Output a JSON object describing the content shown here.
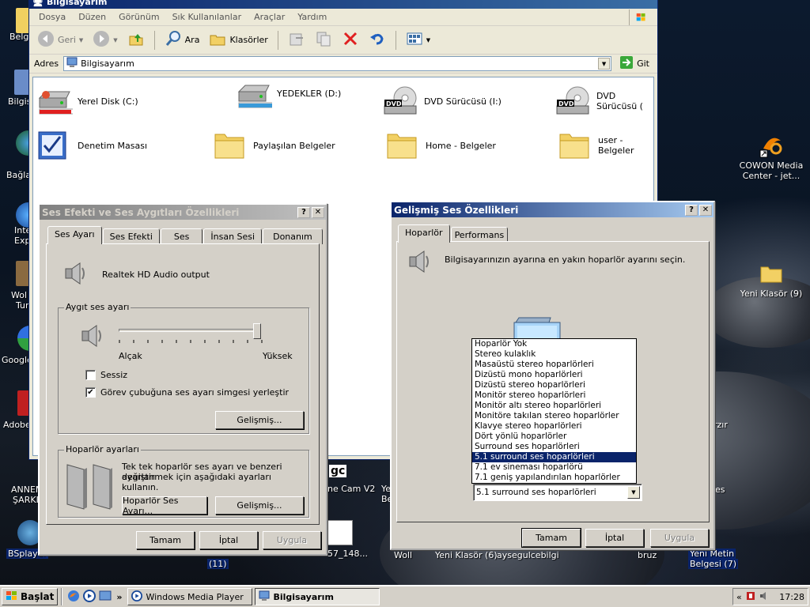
{
  "desktop": {
    "icons": [
      {
        "label": "COWON Media Center - jet...",
        "icon": "cowon-icon"
      },
      {
        "label": "Yeni Klasör (9)",
        "icon": "folder-icon"
      }
    ],
    "fragments": [
      {
        "text": "Belg",
        "name": "desktop-icon-belgelerim"
      },
      {
        "text": "Bilgis",
        "name": "desktop-icon-bilgisayarim"
      },
      {
        "text": "Bağla",
        "name": "desktop-icon-baglantilar"
      },
      {
        "text": "Inte",
        "name": "desktop-icon-internet-1"
      },
      {
        "text": "Exp",
        "name": "desktop-icon-internet-2"
      },
      {
        "text": "Wol",
        "name": "desktop-icon-wol-1"
      },
      {
        "text": "Tur",
        "name": "desktop-icon-wol-2"
      },
      {
        "text": "Google",
        "name": "desktop-icon-google"
      },
      {
        "text": "Adobe",
        "name": "desktop-icon-adobe"
      },
      {
        "text": "ANNEM",
        "name": "desktop-icon-annem-1"
      },
      {
        "text": "ŞARKI",
        "name": "desktop-icon-annem-2"
      },
      {
        "text": "BSplayer",
        "name": "desktop-icon-bsplayer"
      },
      {
        "text": "(11)",
        "name": "desktop-icon-fragment-11"
      },
      {
        "text": "57_148...",
        "name": "desktop-icon-fragment-57"
      },
      {
        "text": "ne Cam V2",
        "name": "desktop-icon-fragment-cam"
      },
      {
        "text": "gc",
        "name": "desktop-icon-fragment-gc"
      },
      {
        "text": "Ye",
        "name": "desktop-icon-fragment-ye"
      },
      {
        "text": "Be",
        "name": "desktop-icon-fragment-be"
      },
      {
        "text": "rzır",
        "name": "desktop-icon-fragment-rzir"
      },
      {
        "text": "es",
        "name": "desktop-icon-fragment-es"
      },
      {
        "text": "Yeni Metin",
        "name": "desktop-icon-yeni-metin-1"
      },
      {
        "text": "Belgesi (7)",
        "name": "desktop-icon-yeni-metin-2"
      },
      {
        "text": "Woll",
        "name": "desktop-icon-fragment-woll"
      },
      {
        "text": "Yeni Klasör (6)",
        "name": "desktop-icon-fragment-klasor6"
      },
      {
        "text": "aysegulcebilgi",
        "name": "desktop-icon-fragment-aysegul"
      },
      {
        "text": "bruz",
        "name": "desktop-icon-fragment-bruz"
      }
    ]
  },
  "explorer": {
    "title": "Bilgisayarım",
    "menu": [
      "Dosya",
      "Düzen",
      "Görünüm",
      "Sık Kullanılanlar",
      "Araçlar",
      "Yardım"
    ],
    "toolbar": {
      "back": "Geri",
      "search": "Ara",
      "folders": "Klasörler"
    },
    "address_label": "Adres",
    "address_value": "Bilgisayarım",
    "go_label": "Git",
    "items": [
      {
        "label": "Yerel Disk (C:)",
        "type": "hdd",
        "usage": 0.9
      },
      {
        "label": "YEDEKLER (D:)",
        "type": "hdd",
        "usage": 0.95
      },
      {
        "label": "DVD Sürücüsü (I:)",
        "type": "dvd"
      },
      {
        "label": "DVD Sürücüsü (",
        "type": "dvd"
      },
      {
        "label": "Denetim Masası",
        "type": "control"
      },
      {
        "label": "Paylaşılan Belgeler",
        "type": "folder"
      },
      {
        "label": "Home - Belgeler",
        "type": "folder"
      },
      {
        "label": "user - Belgeler",
        "type": "folder"
      }
    ]
  },
  "sound_dialog": {
    "title": "Ses Efekti ve Ses Aygıtları Özellikleri",
    "tabs": [
      "Ses Ayarı",
      "Ses Efekti",
      "Ses",
      "İnsan Sesi",
      "Donanım"
    ],
    "device_name": "Realtek HD Audio output",
    "volume_group": "Aygıt ses ayarı",
    "volume_level": 0.97,
    "low_label": "Alçak",
    "high_label": "Yüksek",
    "mute_label": "Sessiz",
    "mute_checked": false,
    "tray_label": "Görev çubuğuna ses ayarı simgesi yerleştir",
    "tray_checked": true,
    "advanced_btn": "Gelişmiş...",
    "speaker_group": "Hoparlör ayarları",
    "speaker_text_1": "Tek tek hoparlör ses ayarı ve benzeri ayarları",
    "speaker_text_2": "değiştirmek için aşağıdaki ayarları kullanın.",
    "speaker_volume_btn": "Hoparlör Ses Ayarı...",
    "speaker_advanced_btn": "Gelişmiş...",
    "ok": "Tamam",
    "cancel": "İptal",
    "apply": "Uygula"
  },
  "adv_dialog": {
    "title": "Gelişmiş Ses Özellikleri",
    "tabs": [
      "Hoparlör",
      "Performans"
    ],
    "instruction": "Bilgisayarınızın ayarına en yakın hoparlör ayarını seçin.",
    "selected": "5.1 surround ses hoparlörleri",
    "options": [
      "Hoparlör Yok",
      "Stereo kulaklık",
      "Masaüstü stereo hoparlörleri",
      "Dizüstü mono hoparlörleri",
      "Dizüstü stereo hoparlörleri",
      "Monitör stereo hoparlörleri",
      "Monitör altı stereo hoparlörleri",
      "Monitöre takılan stereo hoparlörler",
      "Klavye stereo hoparlörleri",
      "Dört yönlü hoparlörler",
      "Surround ses hoparlörleri",
      "5.1 surround ses hoparlörleri",
      "7.1 ev sineması hoparlörü",
      "7.1 geniş yapılandırılan hoparlörler"
    ],
    "selected_index": 11,
    "ok": "Tamam",
    "cancel": "İptal",
    "apply": "Uygula"
  },
  "taskbar": {
    "start": "Başlat",
    "tasks": [
      {
        "label": "Windows Media Player",
        "active": false
      },
      {
        "label": "Bilgisayarım",
        "active": true
      }
    ],
    "chevron": "«",
    "quicklaunch_more": "»",
    "clock": "17:28"
  }
}
